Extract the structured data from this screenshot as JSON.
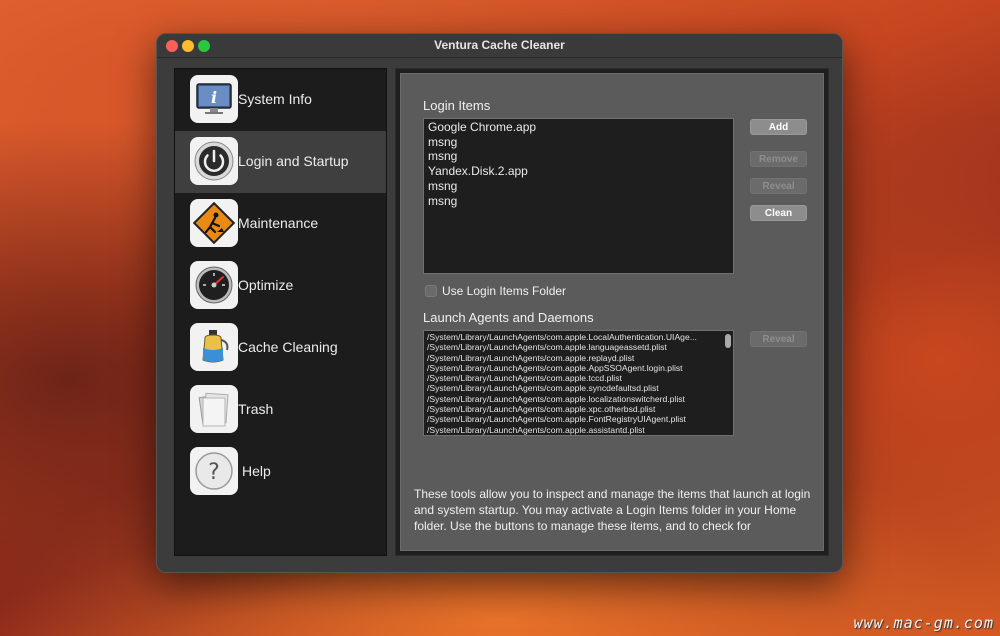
{
  "window": {
    "title": "Ventura Cache Cleaner"
  },
  "sidebar": {
    "items": [
      {
        "label": "System Info",
        "icon": "system-info-icon",
        "selected": false
      },
      {
        "label": "Login and Startup",
        "icon": "power-icon",
        "selected": true
      },
      {
        "label": "Maintenance",
        "icon": "construction-sign-icon",
        "selected": false
      },
      {
        "label": "Optimize",
        "icon": "gauge-icon",
        "selected": false
      },
      {
        "label": "Cache Cleaning",
        "icon": "vacuum-bottle-icon",
        "selected": false
      },
      {
        "label": "Trash",
        "icon": "trash-papers-icon",
        "selected": false
      },
      {
        "label": "Help",
        "icon": "question-mark-icon",
        "selected": false
      }
    ]
  },
  "login_items": {
    "label": "Login Items",
    "items": [
      "Google Chrome.app",
      "msng",
      "msng",
      "Yandex.Disk.2.app",
      "msng",
      "msng"
    ],
    "buttons": {
      "add": {
        "label": "Add",
        "enabled": true
      },
      "remove": {
        "label": "Remove",
        "enabled": false
      },
      "reveal": {
        "label": "Reveal",
        "enabled": false
      },
      "clean": {
        "label": "Clean",
        "enabled": true
      }
    },
    "folder_checkbox": {
      "label": "Use Login Items Folder",
      "checked": false
    }
  },
  "launch_agents": {
    "label": "Launch Agents and Daemons",
    "items": [
      "/System/Library/LaunchAgents/com.apple.LocalAuthentication.UIAge...",
      "/System/Library/LaunchAgents/com.apple.languageassetd.plist",
      "/System/Library/LaunchAgents/com.apple.replayd.plist",
      "/System/Library/LaunchAgents/com.apple.AppSSOAgent.login.plist",
      "/System/Library/LaunchAgents/com.apple.tccd.plist",
      "/System/Library/LaunchAgents/com.apple.syncdefaultsd.plist",
      "/System/Library/LaunchAgents/com.apple.localizationswitcherd.plist",
      "/System/Library/LaunchAgents/com.apple.xpc.otherbsd.plist",
      "/System/Library/LaunchAgents/com.apple.FontRegistryUIAgent.plist",
      "/System/Library/LaunchAgents/com.apple.assistantd.plist"
    ],
    "reveal_button": {
      "label": "Reveal",
      "enabled": false
    }
  },
  "description": "These tools allow you to inspect and manage the items that launch at login and system startup.  You may activate a Login Items folder in your Home folder.  Use the buttons to manage these items, and to check for",
  "watermark": "www.mac-gm.com",
  "colors": {
    "window_bg": "#3c3c3c",
    "sidebar_bg": "#1c1c1c",
    "selected_row": "#3f3f3f",
    "panel_bg": "#5b5b5b"
  }
}
